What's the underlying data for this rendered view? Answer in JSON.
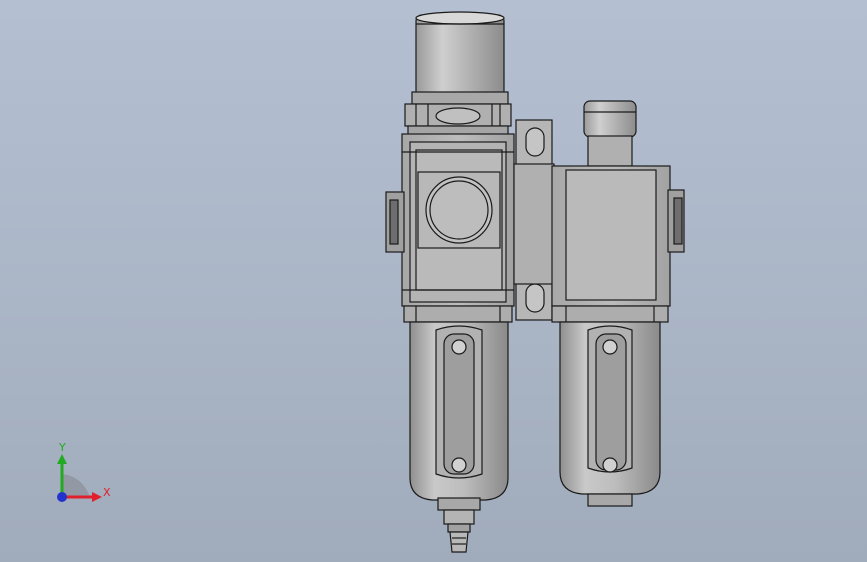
{
  "viewport": {
    "background_top": "#b4c0d2",
    "background_bottom": "#a0abbb"
  },
  "model": {
    "description_icon": "filter-regulator-lubricator-assembly-icon",
    "body_color": "#b9b9b9",
    "edge_color": "#1a1a1a"
  },
  "triad": {
    "x_label": "X",
    "y_label": "Y",
    "x_color": "#e0202a",
    "y_color": "#22aa22",
    "z_color": "#2233cc"
  }
}
